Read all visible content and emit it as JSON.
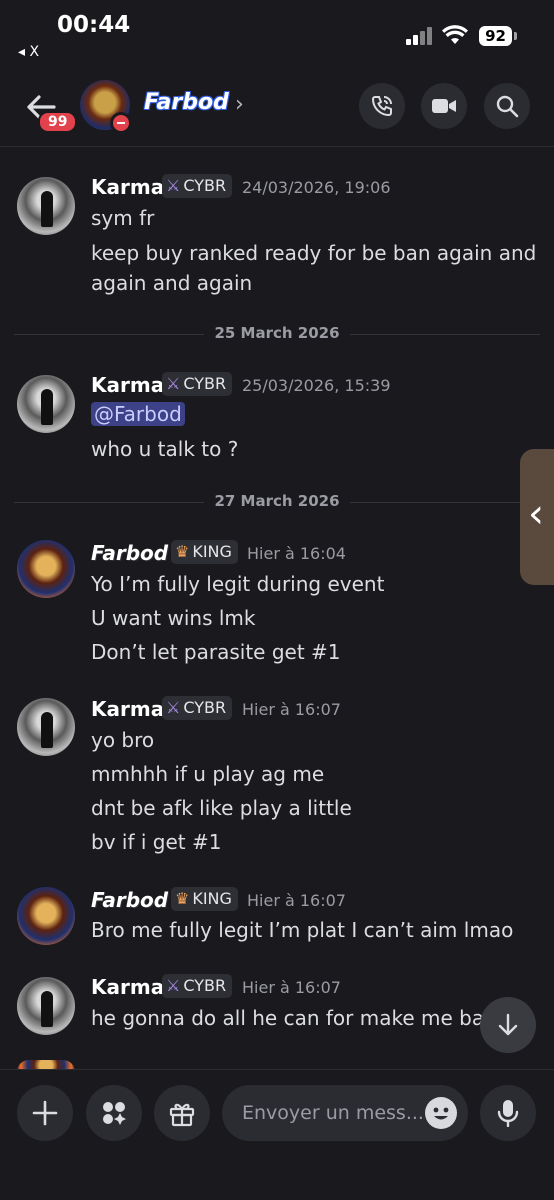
{
  "status_bar": {
    "time": "00:44",
    "back_app_label": "◂ X",
    "battery": "92"
  },
  "header": {
    "unread_count": "99",
    "channel_name": "Farbod",
    "icons": [
      "back-arrow-icon",
      "phone-call-icon",
      "video-camera-icon",
      "search-icon",
      "chevron-right-icon"
    ]
  },
  "colors": {
    "mention_bg": "#3c4188",
    "dnd": "#e2424b",
    "background": "#1a1a1e"
  },
  "messages": [
    {
      "author": "Karma",
      "tag": "CYBR",
      "time": "24/03/2026, 19:06",
      "lines": [
        "sym fr",
        "keep buy ranked ready for be ban again and",
        "again and again"
      ]
    },
    {
      "divider": "25 March 2026"
    },
    {
      "author": "Karma",
      "tag": "CYBR",
      "time": "25/03/2026, 15:39",
      "mention": "@Farbod",
      "lines": [
        "who u talk to ?"
      ]
    },
    {
      "divider": "27 March 2026"
    },
    {
      "author": "Farbod",
      "tag": "KING",
      "time": "Hier à 16:04",
      "lines": [
        "Yo I’m fully legit during event",
        "U want wins lmk",
        "Don’t let parasite get #1"
      ]
    },
    {
      "author": "Karma",
      "tag": "CYBR",
      "time": "Hier à 16:07",
      "lines": [
        "yo bro",
        "mmhhh if u play ag me",
        "dnt be afk like play a little",
        "bv if i get #1"
      ]
    },
    {
      "author": "Farbod",
      "tag": "KING",
      "time": "Hier à 16:07",
      "lines": [
        "Bro me fully legit I’m plat I can’t aim lmao"
      ]
    },
    {
      "author": "Karma",
      "tag": "CYBR",
      "time": "Hier à 16:07",
      "lines": [
        "he gonna do all he can for make me ban"
      ]
    }
  ],
  "composer": {
    "placeholder": "Envoyer un mess..."
  }
}
